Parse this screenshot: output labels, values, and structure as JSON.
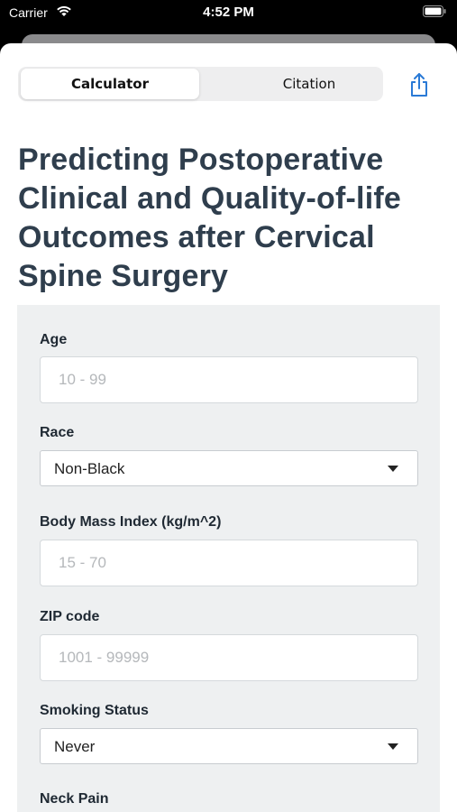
{
  "status_bar": {
    "carrier": "Carrier",
    "time": "4:52 PM"
  },
  "tabs": [
    {
      "label": "Calculator",
      "active": true
    },
    {
      "label": "Citation",
      "active": false
    }
  ],
  "title": "Predicting Postoperative Clinical and Quality-of-life Outcomes after Cervical Spine Surgery",
  "form": {
    "age": {
      "label": "Age",
      "placeholder": "10 - 99"
    },
    "race": {
      "label": "Race",
      "value": "Non-Black"
    },
    "bmi": {
      "label": "Body Mass Index (kg/m^2)",
      "placeholder": "15 - 70"
    },
    "zip": {
      "label": "ZIP code",
      "placeholder": "1001 - 99999"
    },
    "smoking": {
      "label": "Smoking Status",
      "value": "Never"
    },
    "neck_pain": {
      "label": "Neck Pain"
    }
  },
  "icons": {
    "wifi": "wifi-icon",
    "battery": "battery-icon",
    "share": "share-icon",
    "dropdown": "caret-down-icon"
  },
  "colors": {
    "accent": "#2a7ad6",
    "title": "#2f3e4d",
    "panel": "#eef0f1"
  }
}
